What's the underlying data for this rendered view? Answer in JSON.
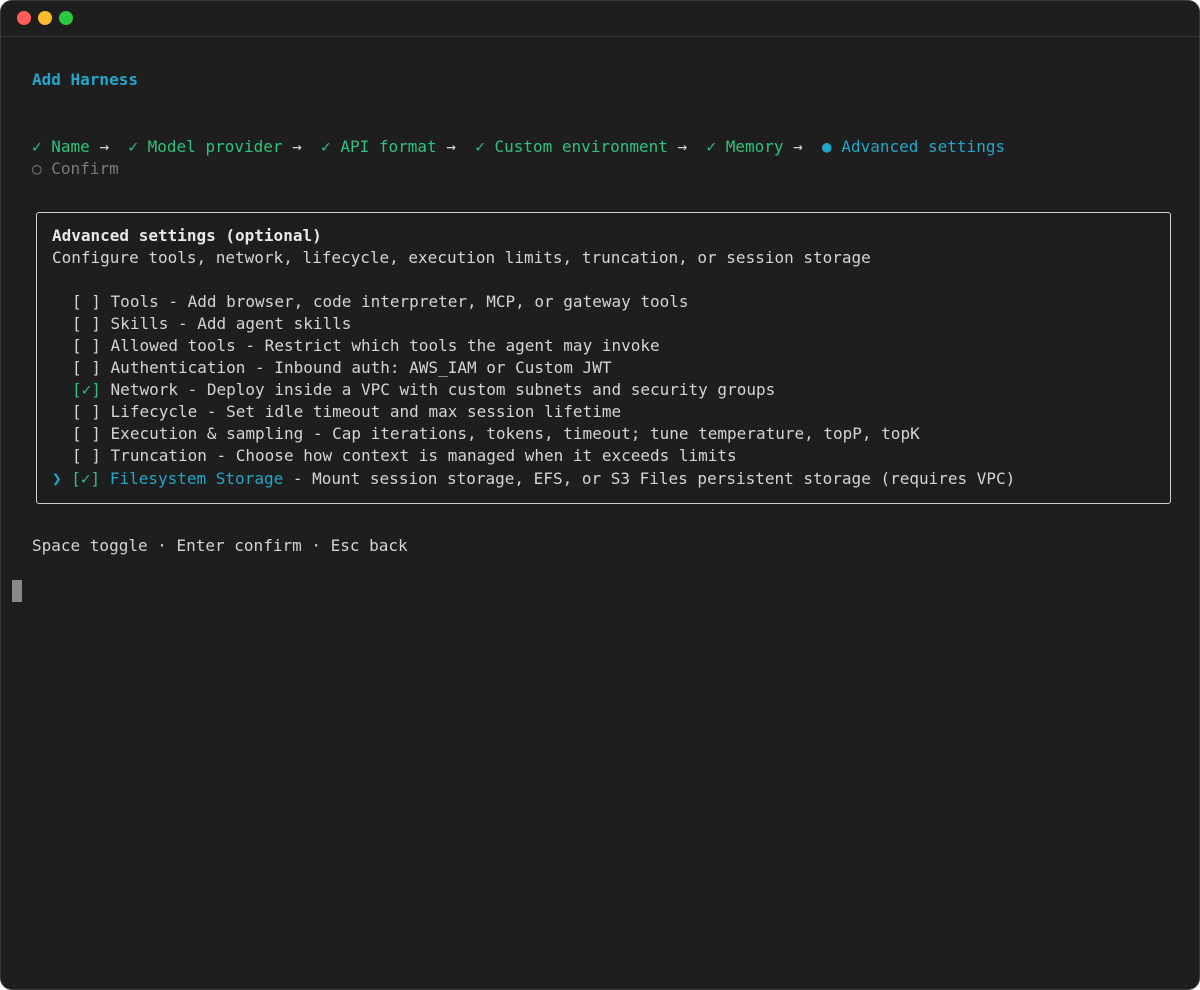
{
  "window": {
    "traffic_lights": [
      "close",
      "minimize",
      "maximize"
    ]
  },
  "header": {
    "title": "Add Harness"
  },
  "steps": [
    {
      "mark": "✓",
      "label": "Name",
      "state": "done"
    },
    {
      "mark": "✓",
      "label": "Model provider",
      "state": "done"
    },
    {
      "mark": "✓",
      "label": "API format",
      "state": "done"
    },
    {
      "mark": "✓",
      "label": "Custom environment",
      "state": "done"
    },
    {
      "mark": "✓",
      "label": "Memory",
      "state": "done"
    },
    {
      "mark": "●",
      "label": "Advanced settings",
      "state": "current"
    },
    {
      "mark": "○",
      "label": "Confirm",
      "state": "pending"
    }
  ],
  "step_separator": "→",
  "panel": {
    "heading": "Advanced settings (optional)",
    "description": "Configure tools, network, lifecycle, execution limits, truncation, or session storage",
    "options": [
      {
        "checkbox": "[ ]",
        "name": "Tools",
        "desc": " - Add browser, code interpreter, MCP, or gateway tools",
        "checked": false,
        "focused": false
      },
      {
        "checkbox": "[ ]",
        "name": "Skills",
        "desc": " - Add agent skills",
        "checked": false,
        "focused": false
      },
      {
        "checkbox": "[ ]",
        "name": "Allowed tools",
        "desc": " - Restrict which tools the agent may invoke",
        "checked": false,
        "focused": false
      },
      {
        "checkbox": "[ ]",
        "name": "Authentication",
        "desc": " - Inbound auth: AWS_IAM or Custom JWT",
        "checked": false,
        "focused": false
      },
      {
        "checkbox": "[✓]",
        "name": "Network",
        "desc": " - Deploy inside a VPC with custom subnets and security groups",
        "checked": true,
        "focused": false
      },
      {
        "checkbox": "[ ]",
        "name": "Lifecycle",
        "desc": " - Set idle timeout and max session lifetime",
        "checked": false,
        "focused": false
      },
      {
        "checkbox": "[ ]",
        "name": "Execution & sampling",
        "desc": " - Cap iterations, tokens, timeout; tune temperature, topP, topK",
        "checked": false,
        "focused": false
      },
      {
        "checkbox": "[ ]",
        "name": "Truncation",
        "desc": " - Choose how context is managed when it exceeds limits",
        "checked": false,
        "focused": false
      },
      {
        "checkbox": "[✓]",
        "name": "Filesystem Storage",
        "desc": " - Mount session storage, EFS, or S3 Files persistent storage (requires VPC)",
        "checked": true,
        "focused": true
      }
    ],
    "focus_pointer": "❯"
  },
  "footer": {
    "hint": "Space toggle · Enter confirm · Esc back"
  },
  "colors": {
    "background": "#1e1e1e",
    "accent_cyan": "#22a7c9",
    "done_green": "#2ec27e",
    "dim": "#7a7a7a",
    "text": "#d4d4d4"
  }
}
